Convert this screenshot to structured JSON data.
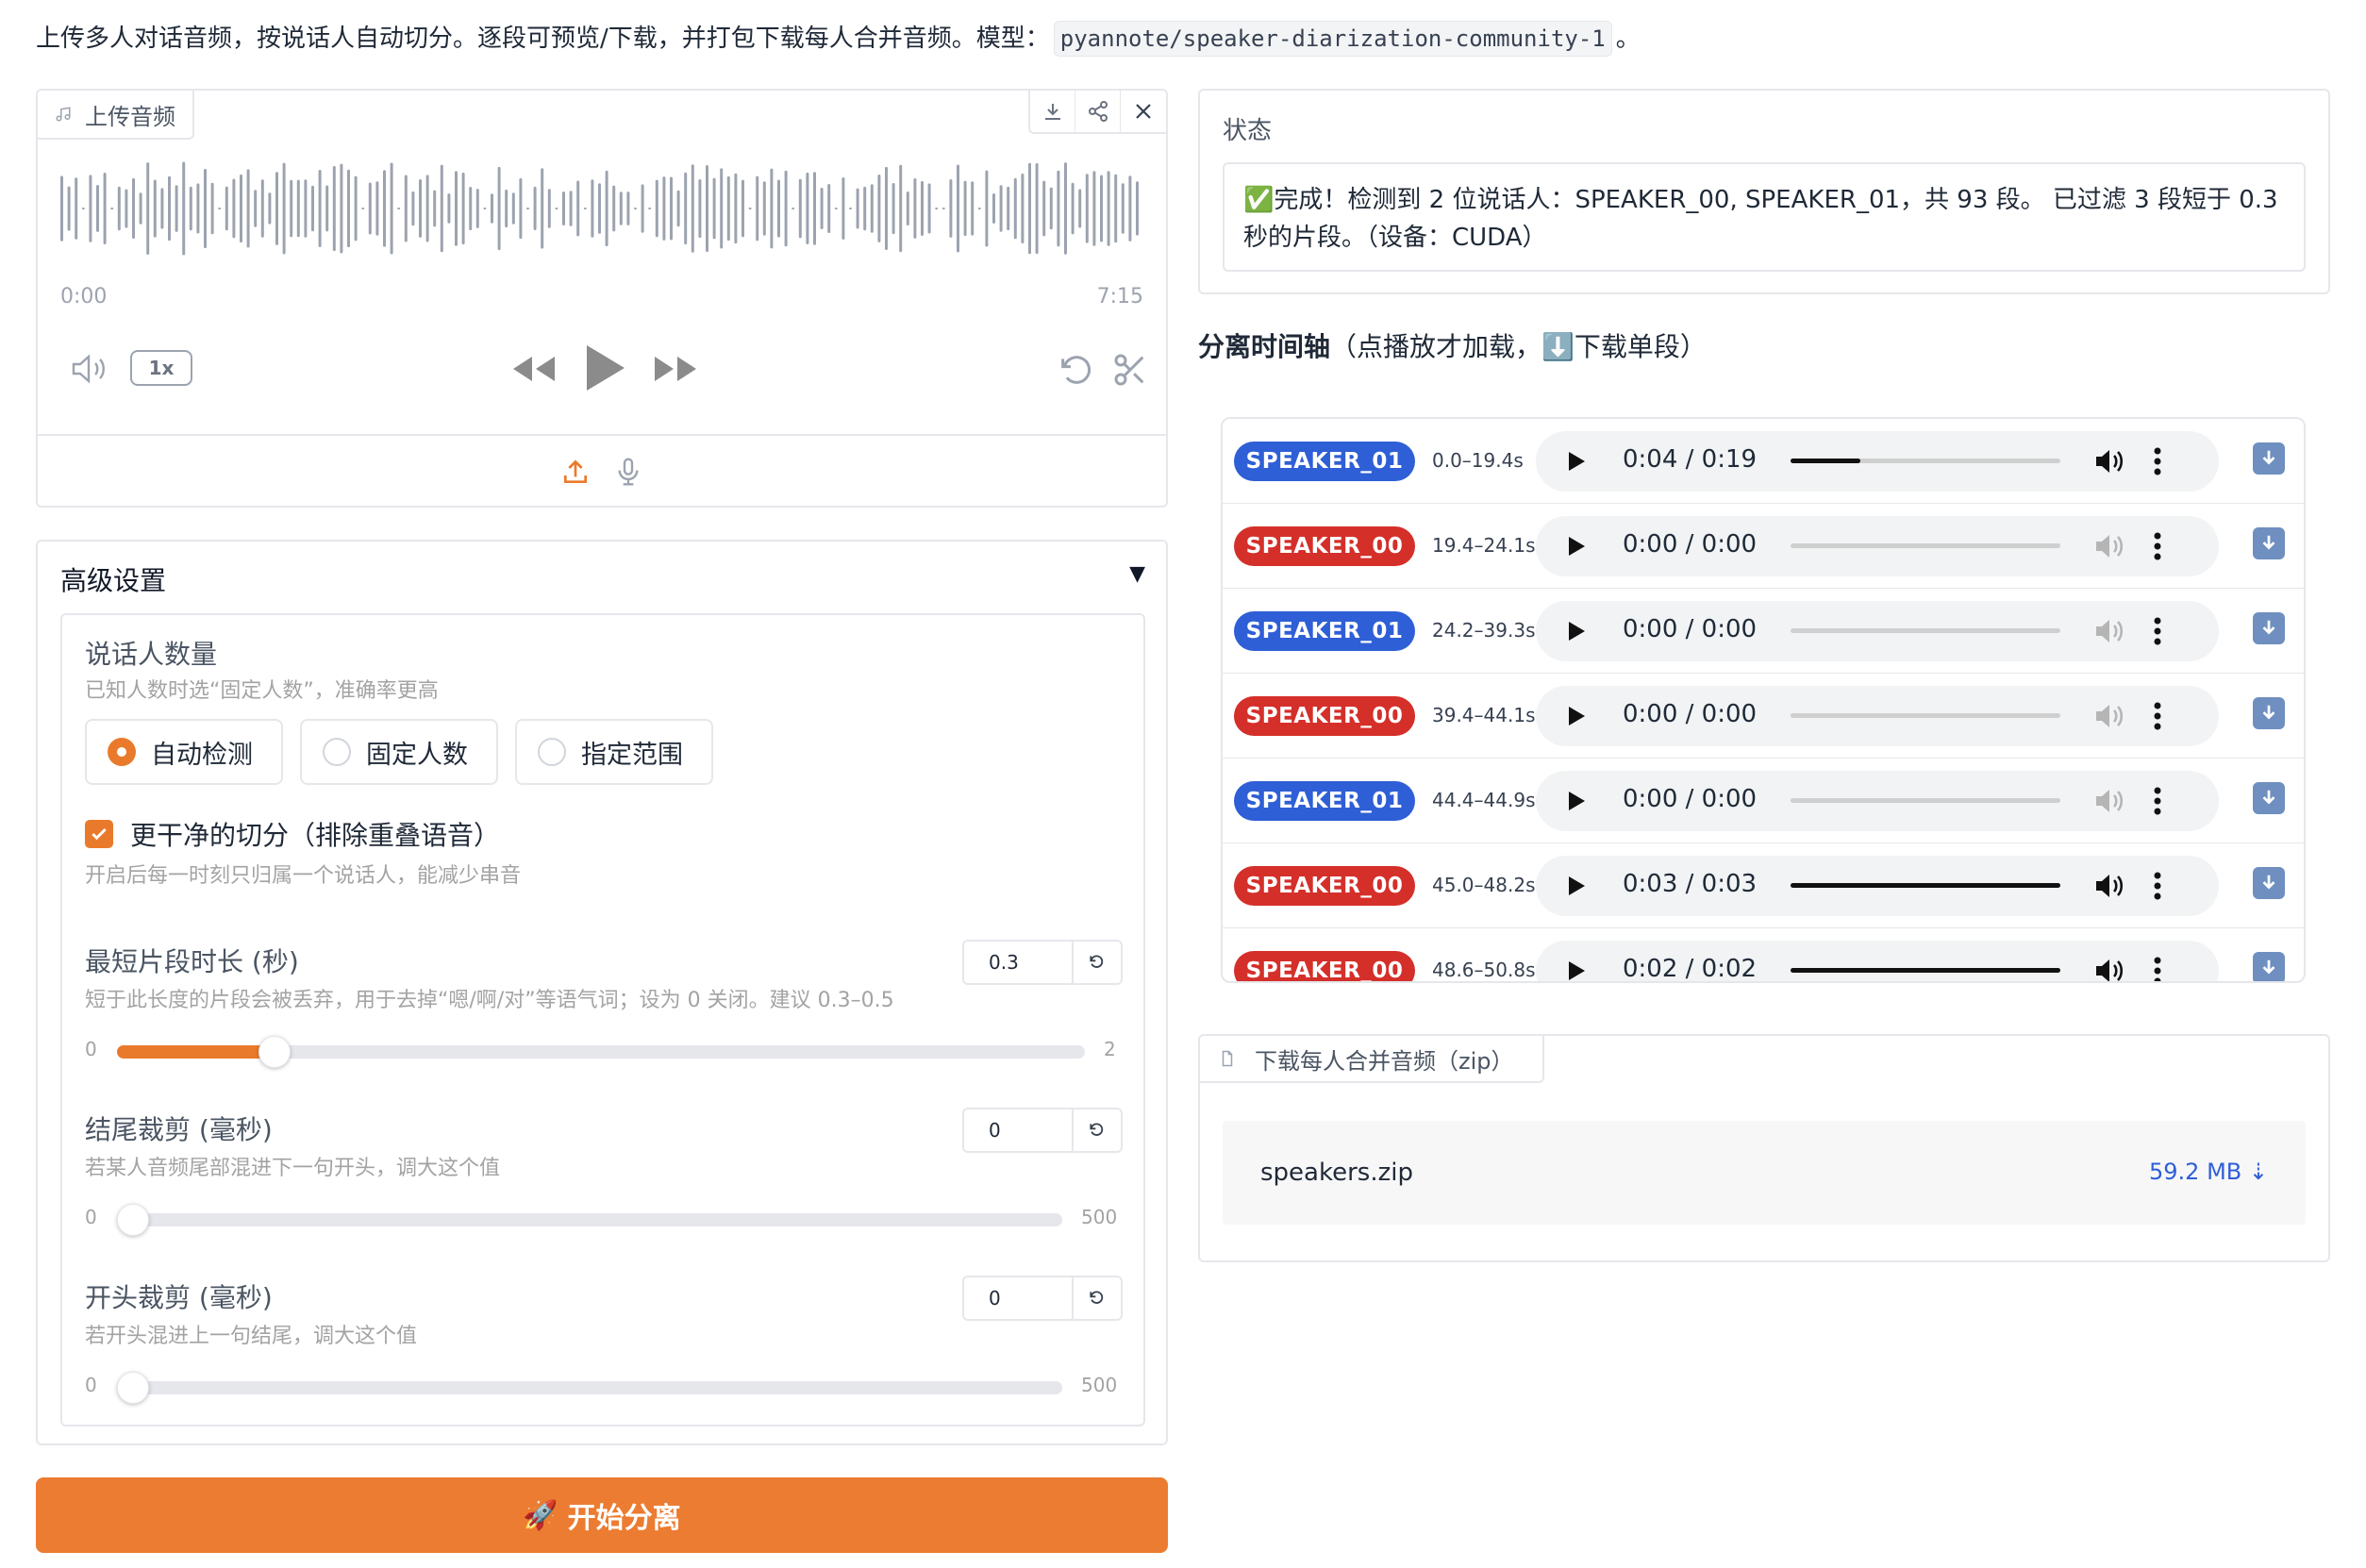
{
  "intro": {
    "text": "上传多人对话音频，按说话人自动切分。逐段可预览/下载，并打包下载每人合并音频。模型：",
    "model": "pyannote/speaker-diarization-community-1",
    "suffix": "。"
  },
  "audio_upload": {
    "label": "上传音频",
    "time_start": "0:00",
    "time_end": "7:15",
    "speed": "1x",
    "icons": [
      "music-note-icon",
      "download-icon",
      "share-icon",
      "close-icon",
      "volume-icon",
      "rewind-icon",
      "play-icon",
      "fast-forward-icon",
      "undo-icon",
      "scissors-icon",
      "upload-icon",
      "microphone-icon"
    ]
  },
  "advanced": {
    "title": "高级设置",
    "arrow": "▼",
    "speaker_count": {
      "label": "说话人数量",
      "info": "已知人数时选“固定人数”，准确率更高",
      "options": [
        "自动检测",
        "固定人数",
        "指定范围"
      ],
      "selected": "自动检测"
    },
    "clean_cut": {
      "label": "更干净的切分（排除重叠语音）",
      "info": "开启后每一时刻只归属一个说话人，能减少串音",
      "checked": true
    },
    "min_segment": {
      "label": "最短片段时长 (秒)",
      "info": "短于此长度的片段会被丢弃，用于去掉“嗯/啊/对”等语气词；设为 0 关闭。建议 0.3–0.5",
      "value": "0.3",
      "min": "0",
      "max": "2"
    },
    "tail_trim": {
      "label": "结尾裁剪 (毫秒)",
      "info": "若某人音频尾部混进下一句开头，调大这个值",
      "value": "0",
      "min": "0",
      "max": "500"
    },
    "head_trim": {
      "label": "开头裁剪 (毫秒)",
      "info": "若开头混进上一句结尾，调大这个值",
      "value": "0",
      "min": "0",
      "max": "500"
    }
  },
  "run_button": {
    "icon": "🚀",
    "label": "开始分离"
  },
  "status": {
    "label": "状态",
    "icon": "✅",
    "message": "完成！检测到 2 位说话人：SPEAKER_00, SPEAKER_01，共 93 段。 已过滤 3 段短于 0.3 秒的片段。（设备：CUDA）"
  },
  "timeline": {
    "title_bold": "分离时间轴",
    "title_rest": "（点播放才加载，",
    "title_icon": "⬇️",
    "title_tail": "下载单段）",
    "segments": [
      {
        "speaker": "SPEAKER_01",
        "range": "0.0–19.4s",
        "time": "0:04 / 0:19",
        "progress": 0.26,
        "active": true
      },
      {
        "speaker": "SPEAKER_00",
        "range": "19.4–24.1s",
        "time": "0:00 / 0:00",
        "progress": 0,
        "active": false
      },
      {
        "speaker": "SPEAKER_01",
        "range": "24.2–39.3s",
        "time": "0:00 / 0:00",
        "progress": 0,
        "active": false
      },
      {
        "speaker": "SPEAKER_00",
        "range": "39.4–44.1s",
        "time": "0:00 / 0:00",
        "progress": 0,
        "active": false
      },
      {
        "speaker": "SPEAKER_01",
        "range": "44.4–44.9s",
        "time": "0:00 / 0:00",
        "progress": 0,
        "active": false
      },
      {
        "speaker": "SPEAKER_00",
        "range": "45.0–48.2s",
        "time": "0:03 / 0:03",
        "progress": 1,
        "active": true
      },
      {
        "speaker": "SPEAKER_00",
        "range": "48.6–50.8s",
        "time": "0:02 / 0:02",
        "progress": 1,
        "active": true
      }
    ]
  },
  "zip": {
    "label": "下载每人合并音频（zip）",
    "file_name": "speakers.zip",
    "file_size": "59.2 MB ⇣"
  },
  "colors": {
    "accent": "#ec7c31",
    "speaker_00": "#d52f2a",
    "speaker_01": "#2f5fd6"
  }
}
